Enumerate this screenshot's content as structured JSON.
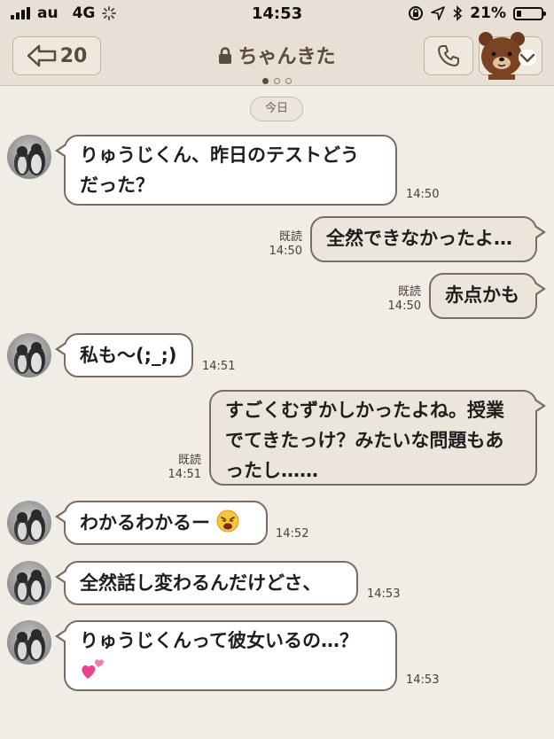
{
  "status_bar": {
    "carrier": "au",
    "network": "4G",
    "time": "14:53",
    "battery": "21%",
    "battery_level": 0.21
  },
  "header": {
    "back_count": "20",
    "title": "ちゃんきた",
    "page_indicator": {
      "total": 3,
      "current": 1
    }
  },
  "date_label": "今日",
  "read_label": "既読",
  "messages": [
    {
      "direction": "in",
      "text_lines": [
        "りゅうじくん、昨日のテストどう",
        "だった？"
      ],
      "time": "14:50"
    },
    {
      "direction": "out",
      "text_lines": [
        "全然できなかったよ…"
      ],
      "time": "14:50",
      "read": "既読"
    },
    {
      "direction": "out",
      "text_lines": [
        "赤点かも"
      ],
      "time": "14:50",
      "read": "既読"
    },
    {
      "direction": "in",
      "text_lines": [
        "私も〜(;_;)"
      ],
      "time": "14:51"
    },
    {
      "direction": "out",
      "text_lines": [
        "すごくむずかしかったよね。授業",
        "でてきたっけ？みたいな問題もあ",
        "ったし……"
      ],
      "time": "14:51",
      "read": "既読"
    },
    {
      "direction": "in",
      "text_lines": [
        "わかるわかるー"
      ],
      "emoji": "weary-face-icon",
      "time": "14:52"
    },
    {
      "direction": "in",
      "text_lines": [
        "全然話し変わるんだけどさ、"
      ],
      "time": "14:53"
    },
    {
      "direction": "in",
      "text_lines": [
        "りゅうじくんって彼女いるの…？"
      ],
      "emoji": "two-hearts-icon",
      "time": "14:53"
    }
  ],
  "colors": {
    "background": "#f1ece6",
    "header": "#e8e0d6",
    "bubble_border": "#7a6d60",
    "incoming_bubble": "#ffffff",
    "outgoing_bubble": "#ece5dc",
    "accent_text": "#5a4b3c"
  }
}
